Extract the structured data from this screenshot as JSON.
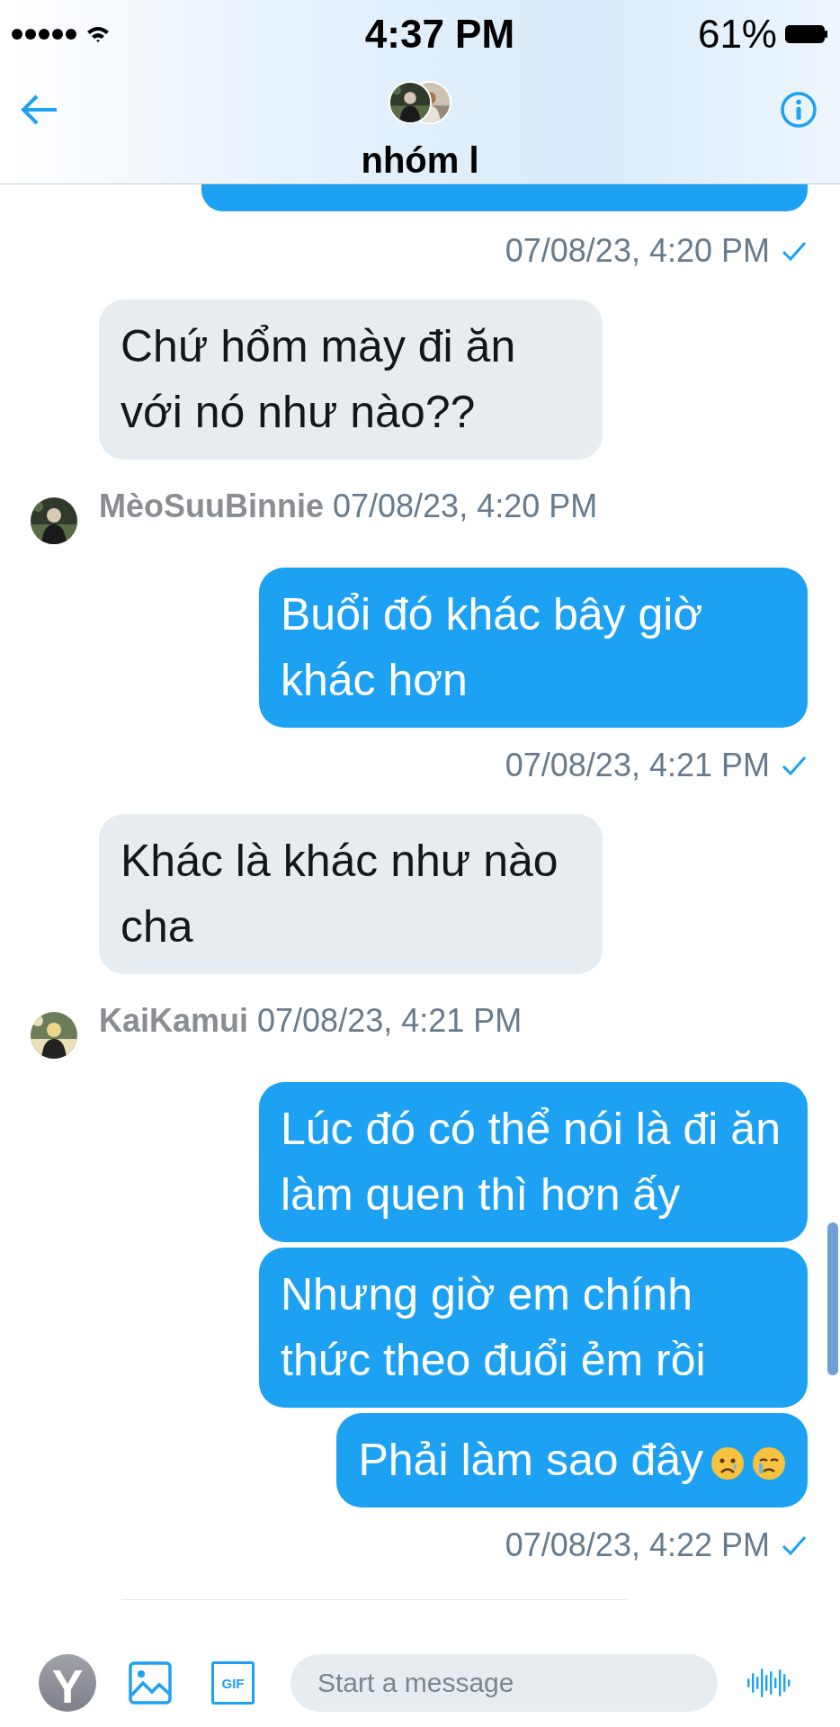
{
  "status_bar": {
    "time": "4:37 PM",
    "battery": "61%"
  },
  "header": {
    "title": "nhóm l"
  },
  "thread": [
    {
      "kind": "status",
      "time": "07/08/23, 4:20 PM",
      "seen": true
    },
    {
      "kind": "received",
      "bubbles": [
        {
          "text": "Chứ hổm mày đi ăn với nó như nào??"
        }
      ],
      "sender": "MèoSuuBinnie",
      "time": "07/08/23, 4:20 PM"
    },
    {
      "kind": "sent",
      "bubbles": [
        {
          "text": "Buổi đó khác bây giờ khác hơn"
        }
      ],
      "time": "07/08/23, 4:21 PM",
      "seen": true
    },
    {
      "kind": "received",
      "bubbles": [
        {
          "text": "Khác là khác như nào cha"
        }
      ],
      "sender": "KaiKamui",
      "time": "07/08/23, 4:21 PM"
    },
    {
      "kind": "sent",
      "bubbles": [
        {
          "text": "Lúc đó có thể nói là đi ăn làm quen thì hơn ấy"
        },
        {
          "text": "Nhưng giờ em chính thức theo đuổi ẻm rồi"
        },
        {
          "text": "Phải làm sao đây",
          "icons": [
            {
              "kind": "sad-face"
            },
            {
              "kind": "crying-face"
            }
          ]
        }
      ],
      "time": "07/08/23, 4:22 PM",
      "seen": true
    }
  ],
  "composer": {
    "avatar_letter": "Y",
    "gif_label": "GIF",
    "placeholder": "Start a message"
  }
}
